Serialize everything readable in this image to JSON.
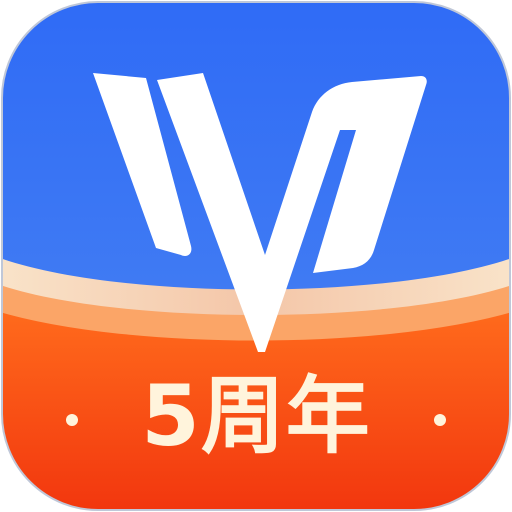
{
  "app_icon": {
    "badge_text": "5周年",
    "colors": {
      "top_blue": "#2F6BF6",
      "mid_blue": "#4E86F0",
      "light_band": "#F6D6BC",
      "orange": "#FF5A1A",
      "red": "#F23D12",
      "logo_white": "#FFFFFF",
      "badge_cream": "#FFF4DC"
    },
    "icons": [
      "v-logo-icon",
      "decorative-dot-icon"
    ]
  }
}
